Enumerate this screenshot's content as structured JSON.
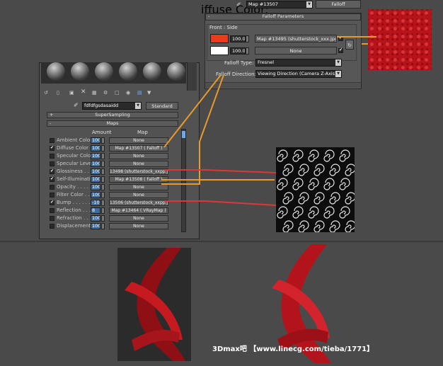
{
  "top_panel": {
    "diffuse_label": "iffuse Color:",
    "map_dropdown": "Map #13507",
    "type_button": "Falloff",
    "falloff_params": "Falloff Parameters",
    "front_side": "Front : Side",
    "row1_amount": "100.0",
    "row1_map": "Map #13495 (shutterstock_xxx.jpg)",
    "row2_amount": "100.0",
    "row2_map": "None",
    "falloff_type_label": "Falloff Type:",
    "falloff_type_value": "Fresnel",
    "falloff_dir_label": "Falloff Direction:",
    "falloff_dir_value": "Viewing Direction (Camera Z-Axis)",
    "colors": {
      "front": "#ee3a1a",
      "side": "#ffffff"
    }
  },
  "left_panel": {
    "material_name": "fdfdfgsdasaidd",
    "standard_button": "Standard",
    "supersampling": "SuperSampling",
    "maps_rollout": "Maps",
    "col_amount": "Amount",
    "col_map": "Map",
    "rows": [
      {
        "label": "Ambient Color . .",
        "checked": false,
        "amount": "100",
        "map": "None"
      },
      {
        "label": "Diffuse Color . .",
        "checked": true,
        "amount": "100",
        "map": "Map #13507 ( Falloff )"
      },
      {
        "label": "Specular Color . .",
        "checked": false,
        "amount": "100",
        "map": "None"
      },
      {
        "label": "Specular Level . .",
        "checked": false,
        "amount": "100",
        "map": "None"
      },
      {
        "label": "Glossiness . . . .",
        "checked": true,
        "amount": "100",
        "map": "13498 (shutterstock_xxpp.jpg)"
      },
      {
        "label": "Self-Illumination .",
        "checked": true,
        "amount": "100",
        "map": "Map #13508 ( Falloff )"
      },
      {
        "label": "Opacity . . . . .",
        "checked": false,
        "amount": "100",
        "map": "None"
      },
      {
        "label": "Filter Color . . .",
        "checked": false,
        "amount": "100",
        "map": "None"
      },
      {
        "label": "Bump . . . . . . .",
        "checked": true,
        "amount": "-10",
        "map": "13506 (shutterstock_xxpp.jpg)"
      },
      {
        "label": "Reflection . . . .",
        "checked": false,
        "amount": "8",
        "map": "Map #13464 ( VRayMap )"
      },
      {
        "label": "Refraction . . . .",
        "checked": false,
        "amount": "100",
        "map": "None"
      },
      {
        "label": "Displacement . . .",
        "checked": false,
        "amount": "100",
        "map": "None"
      }
    ]
  },
  "watermark": "3Dmax吧 【www.linecg.com/tieba/1771】"
}
